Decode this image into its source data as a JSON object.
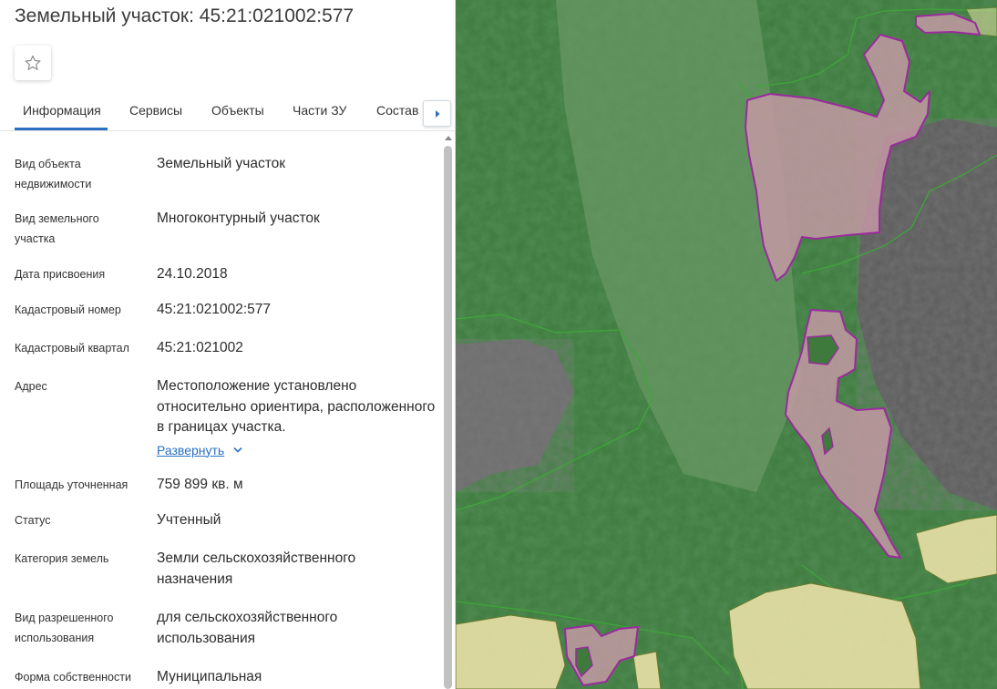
{
  "header": {
    "title": "Земельный участок: 45:21:021002:577"
  },
  "tabs": [
    {
      "label": "Информация"
    },
    {
      "label": "Сервисы"
    },
    {
      "label": "Объекты"
    },
    {
      "label": "Части ЗУ"
    },
    {
      "label": "Состав"
    }
  ],
  "fields": [
    {
      "label": "Вид объекта недвижимости",
      "value": "Земельный участок"
    },
    {
      "label": "Вид земельного участка",
      "value": "Многоконтурный участок"
    },
    {
      "label": "Дата присвоения",
      "value": "24.10.2018"
    },
    {
      "label": "Кадастровый номер",
      "value": "45:21:021002:577"
    },
    {
      "label": "Кадастровый квартал",
      "value": "45:21:021002"
    },
    {
      "label": "Адрес",
      "value": "Местоположение установлено относительно ориентира, расположенного в границах участка.",
      "expand": "Развернуть"
    },
    {
      "label": "Площадь уточненная",
      "value": "759 899 кв. м"
    },
    {
      "label": "Статус",
      "value": "Учтенный"
    },
    {
      "label": "Категория земель",
      "value": "Земли сельскохозяйственного назначения"
    },
    {
      "label": "Вид разрешенного использования",
      "value": "для сельскохозяйственного использования"
    },
    {
      "label": "Форма собственности",
      "value": "Муниципальная"
    }
  ],
  "icons": {
    "favorite": "star-outline-icon",
    "tabs_next": "caret-right-icon",
    "expand": "chevron-down-icon"
  },
  "colors": {
    "accent": "#2a70c2",
    "parcel_fill": "#c79aa6",
    "parcel_border": "#9b2a9e",
    "zone_fill": "#e6dfa6",
    "boundary_green": "#3fa53a"
  }
}
